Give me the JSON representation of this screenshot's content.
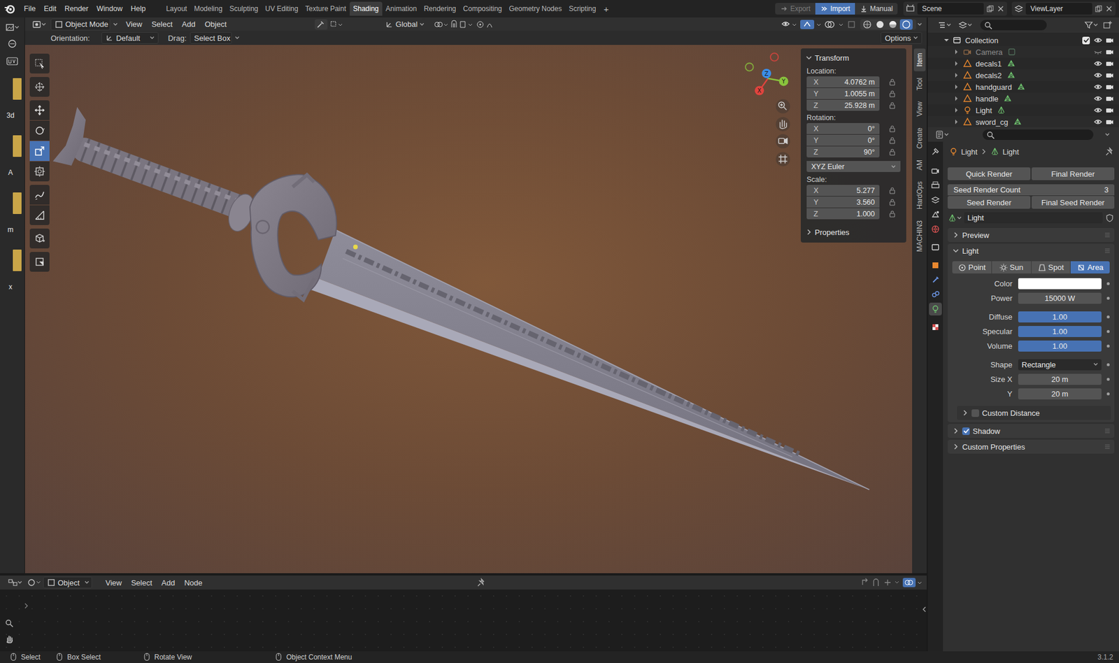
{
  "menubar": {
    "menus": [
      "File",
      "Edit",
      "Render",
      "Window",
      "Help"
    ],
    "workspaces": [
      {
        "label": "Layout",
        "selected": false
      },
      {
        "label": "Modeling",
        "selected": false
      },
      {
        "label": "Sculpting",
        "selected": false
      },
      {
        "label": "UV Editing",
        "selected": false
      },
      {
        "label": "Texture Paint",
        "selected": false
      },
      {
        "label": "Shading",
        "selected": true
      },
      {
        "label": "Animation",
        "selected": false
      },
      {
        "label": "Rendering",
        "selected": false
      },
      {
        "label": "Compositing",
        "selected": false
      },
      {
        "label": "Geometry Nodes",
        "selected": false
      },
      {
        "label": "Scripting",
        "selected": false
      }
    ],
    "add_workspace": "+",
    "buttons": [
      {
        "label": "Export",
        "selected": false,
        "disabled": true
      },
      {
        "label": "Import",
        "selected": true,
        "disabled": false
      },
      {
        "label": "Manual",
        "selected": false,
        "disabled": false
      }
    ],
    "scene": "Scene",
    "view_layer": "ViewLayer"
  },
  "left_strip": {
    "labels": [
      "3d",
      "A",
      "m",
      "x"
    ]
  },
  "viewport_header": {
    "mode": "Object Mode",
    "menus": [
      "View",
      "Select",
      "Add",
      "Object"
    ],
    "transform_orientation": "Global"
  },
  "tool_settings": {
    "orientation_label": "Orientation:",
    "orientation": "Default",
    "drag_label": "Drag:",
    "drag": "Select Box",
    "options": "Options"
  },
  "toolbar": {
    "tools": [
      {
        "selected": false
      },
      {
        "selected": false
      },
      {
        "selected": false
      },
      {
        "selected": false
      },
      {
        "selected": true
      },
      {
        "selected": false
      },
      {
        "selected": false
      },
      {
        "selected": false
      },
      {
        "selected": false
      },
      {
        "selected": false
      }
    ]
  },
  "gizmo": {
    "axes": [
      {
        "label": "X",
        "color": "#e0443e"
      },
      {
        "label": "Y",
        "color": "#8ac33d"
      },
      {
        "label": "Z",
        "color": "#3b8ee8"
      }
    ]
  },
  "transform": {
    "title": "Transform",
    "expanded": true,
    "location": {
      "label": "Location:",
      "fields": [
        {
          "axis": "X",
          "value": "4.0762 m"
        },
        {
          "axis": "Y",
          "value": "1.0055 m"
        },
        {
          "axis": "Z",
          "value": "25.928 m"
        }
      ]
    },
    "rotation": {
      "label": "Rotation:",
      "fields": [
        {
          "axis": "X",
          "value": "0°"
        },
        {
          "axis": "Y",
          "value": "0°"
        },
        {
          "axis": "Z",
          "value": "90°"
        }
      ]
    },
    "rotation_mode": "XYZ Euler",
    "scale": {
      "label": "Scale:",
      "fields": [
        {
          "axis": "X",
          "value": "5.277"
        },
        {
          "axis": "Y",
          "value": "3.560"
        },
        {
          "axis": "Z",
          "value": "1.000"
        }
      ]
    },
    "properties": {
      "label": "Properties",
      "expanded": false
    }
  },
  "side_tabs": [
    {
      "label": "Item",
      "selected": true
    },
    {
      "label": "Tool",
      "selected": false
    },
    {
      "label": "View",
      "selected": false
    },
    {
      "label": "Create",
      "selected": false
    },
    {
      "label": "AM",
      "selected": false
    },
    {
      "label": "HardOps",
      "selected": false
    },
    {
      "label": "MACHIN3",
      "selected": false
    }
  ],
  "node_editor": {
    "type": "Object",
    "menus": [
      "View",
      "Select",
      "Add",
      "Node"
    ]
  },
  "outliner": {
    "collection": {
      "name": "Collection",
      "expanded": true,
      "checked": true
    },
    "items": [
      {
        "name": "Camera",
        "kind": "camera",
        "visible": false
      },
      {
        "name": "decals1",
        "kind": "mesh",
        "visible": true
      },
      {
        "name": "decals2",
        "kind": "mesh",
        "visible": true
      },
      {
        "name": "handguard",
        "kind": "mesh",
        "visible": true
      },
      {
        "name": "handle",
        "kind": "mesh",
        "visible": true
      },
      {
        "name": "Light",
        "kind": "light",
        "visible": true
      },
      {
        "name": "sword_cg",
        "kind": "mesh",
        "visible": true
      }
    ]
  },
  "properties": {
    "tabs": [
      {
        "selected": false
      },
      {
        "selected": false
      },
      {
        "selected": false
      },
      {
        "selected": false
      },
      {
        "selected": false
      },
      {
        "selected": false
      },
      {
        "selected": false
      },
      {
        "selected": false
      },
      {
        "selected": false
      },
      {
        "selected": false
      },
      {
        "selected": true
      },
      {
        "selected": false
      }
    ],
    "breadcrumb": [
      "Light",
      "Light"
    ],
    "render_buttons": [
      "Quick Render",
      "Final Render"
    ],
    "seed_count": {
      "label": "Seed Render Count",
      "value": "3"
    },
    "seed_buttons": [
      "Seed Render",
      "Final Seed Render"
    ],
    "datablock": "Light",
    "preview": {
      "label": "Preview",
      "expanded": false
    },
    "light": {
      "label": "Light",
      "expanded": true,
      "types": [
        {
          "label": "Point",
          "selected": false
        },
        {
          "label": "Sun",
          "selected": false
        },
        {
          "label": "Spot",
          "selected": false
        },
        {
          "label": "Area",
          "selected": true
        }
      ],
      "groups": [
        [
          {
            "label": "Color",
            "kind": "color",
            "color": "#ffffff"
          },
          {
            "label": "Power",
            "kind": "number",
            "value": "15000 W"
          }
        ],
        [
          {
            "label": "Diffuse",
            "kind": "slider",
            "value": "1.00",
            "level": 1
          },
          {
            "label": "Specular",
            "kind": "slider",
            "value": "1.00",
            "level": 1
          },
          {
            "label": "Volume",
            "kind": "slider",
            "value": "1.00",
            "level": 1
          }
        ],
        [
          {
            "label": "Shape",
            "kind": "dropdown",
            "value": "Rectangle"
          },
          {
            "label": "Size X",
            "kind": "number",
            "value": "20 m"
          },
          {
            "label": "Y",
            "kind": "number",
            "value": "20 m"
          }
        ]
      ],
      "custom_distance": {
        "label": "Custom Distance",
        "checked": false,
        "expanded": false
      }
    },
    "shadow": {
      "label": "Shadow",
      "checked": true,
      "expanded": false
    },
    "custom_properties": {
      "label": "Custom Properties",
      "expanded": false
    }
  },
  "status_bar": {
    "items": [
      "Select",
      "Box Select",
      "Rotate View",
      "Object Context Menu"
    ],
    "version": "3.1.2"
  }
}
